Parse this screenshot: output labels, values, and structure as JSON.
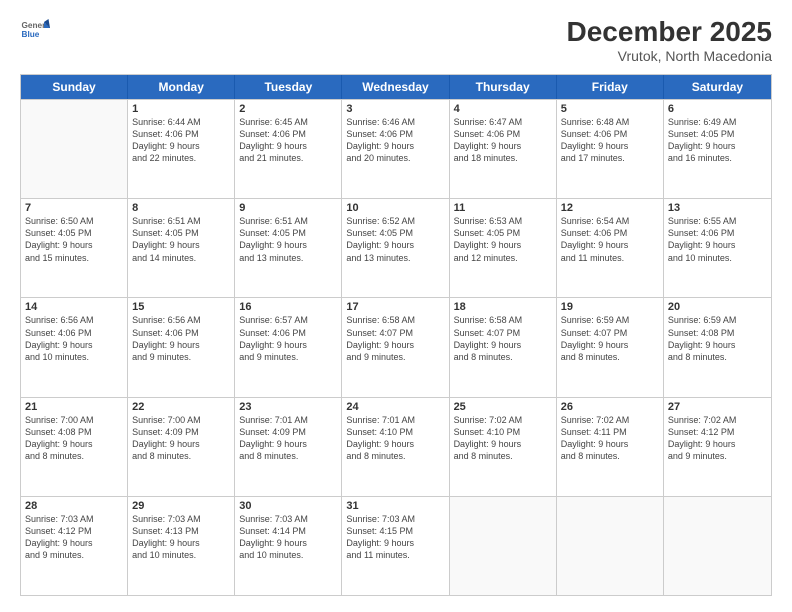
{
  "logo": {
    "general": "General",
    "blue": "Blue"
  },
  "title": "December 2025",
  "subtitle": "Vrutok, North Macedonia",
  "days": [
    "Sunday",
    "Monday",
    "Tuesday",
    "Wednesday",
    "Thursday",
    "Friday",
    "Saturday"
  ],
  "weeks": [
    [
      {
        "day": "",
        "info": ""
      },
      {
        "day": "1",
        "info": "Sunrise: 6:44 AM\nSunset: 4:06 PM\nDaylight: 9 hours\nand 22 minutes."
      },
      {
        "day": "2",
        "info": "Sunrise: 6:45 AM\nSunset: 4:06 PM\nDaylight: 9 hours\nand 21 minutes."
      },
      {
        "day": "3",
        "info": "Sunrise: 6:46 AM\nSunset: 4:06 PM\nDaylight: 9 hours\nand 20 minutes."
      },
      {
        "day": "4",
        "info": "Sunrise: 6:47 AM\nSunset: 4:06 PM\nDaylight: 9 hours\nand 18 minutes."
      },
      {
        "day": "5",
        "info": "Sunrise: 6:48 AM\nSunset: 4:06 PM\nDaylight: 9 hours\nand 17 minutes."
      },
      {
        "day": "6",
        "info": "Sunrise: 6:49 AM\nSunset: 4:05 PM\nDaylight: 9 hours\nand 16 minutes."
      }
    ],
    [
      {
        "day": "7",
        "info": "Sunrise: 6:50 AM\nSunset: 4:05 PM\nDaylight: 9 hours\nand 15 minutes."
      },
      {
        "day": "8",
        "info": "Sunrise: 6:51 AM\nSunset: 4:05 PM\nDaylight: 9 hours\nand 14 minutes."
      },
      {
        "day": "9",
        "info": "Sunrise: 6:51 AM\nSunset: 4:05 PM\nDaylight: 9 hours\nand 13 minutes."
      },
      {
        "day": "10",
        "info": "Sunrise: 6:52 AM\nSunset: 4:05 PM\nDaylight: 9 hours\nand 13 minutes."
      },
      {
        "day": "11",
        "info": "Sunrise: 6:53 AM\nSunset: 4:05 PM\nDaylight: 9 hours\nand 12 minutes."
      },
      {
        "day": "12",
        "info": "Sunrise: 6:54 AM\nSunset: 4:06 PM\nDaylight: 9 hours\nand 11 minutes."
      },
      {
        "day": "13",
        "info": "Sunrise: 6:55 AM\nSunset: 4:06 PM\nDaylight: 9 hours\nand 10 minutes."
      }
    ],
    [
      {
        "day": "14",
        "info": "Sunrise: 6:56 AM\nSunset: 4:06 PM\nDaylight: 9 hours\nand 10 minutes."
      },
      {
        "day": "15",
        "info": "Sunrise: 6:56 AM\nSunset: 4:06 PM\nDaylight: 9 hours\nand 9 minutes."
      },
      {
        "day": "16",
        "info": "Sunrise: 6:57 AM\nSunset: 4:06 PM\nDaylight: 9 hours\nand 9 minutes."
      },
      {
        "day": "17",
        "info": "Sunrise: 6:58 AM\nSunset: 4:07 PM\nDaylight: 9 hours\nand 9 minutes."
      },
      {
        "day": "18",
        "info": "Sunrise: 6:58 AM\nSunset: 4:07 PM\nDaylight: 9 hours\nand 8 minutes."
      },
      {
        "day": "19",
        "info": "Sunrise: 6:59 AM\nSunset: 4:07 PM\nDaylight: 9 hours\nand 8 minutes."
      },
      {
        "day": "20",
        "info": "Sunrise: 6:59 AM\nSunset: 4:08 PM\nDaylight: 9 hours\nand 8 minutes."
      }
    ],
    [
      {
        "day": "21",
        "info": "Sunrise: 7:00 AM\nSunset: 4:08 PM\nDaylight: 9 hours\nand 8 minutes."
      },
      {
        "day": "22",
        "info": "Sunrise: 7:00 AM\nSunset: 4:09 PM\nDaylight: 9 hours\nand 8 minutes."
      },
      {
        "day": "23",
        "info": "Sunrise: 7:01 AM\nSunset: 4:09 PM\nDaylight: 9 hours\nand 8 minutes."
      },
      {
        "day": "24",
        "info": "Sunrise: 7:01 AM\nSunset: 4:10 PM\nDaylight: 9 hours\nand 8 minutes."
      },
      {
        "day": "25",
        "info": "Sunrise: 7:02 AM\nSunset: 4:10 PM\nDaylight: 9 hours\nand 8 minutes."
      },
      {
        "day": "26",
        "info": "Sunrise: 7:02 AM\nSunset: 4:11 PM\nDaylight: 9 hours\nand 8 minutes."
      },
      {
        "day": "27",
        "info": "Sunrise: 7:02 AM\nSunset: 4:12 PM\nDaylight: 9 hours\nand 9 minutes."
      }
    ],
    [
      {
        "day": "28",
        "info": "Sunrise: 7:03 AM\nSunset: 4:12 PM\nDaylight: 9 hours\nand 9 minutes."
      },
      {
        "day": "29",
        "info": "Sunrise: 7:03 AM\nSunset: 4:13 PM\nDaylight: 9 hours\nand 10 minutes."
      },
      {
        "day": "30",
        "info": "Sunrise: 7:03 AM\nSunset: 4:14 PM\nDaylight: 9 hours\nand 10 minutes."
      },
      {
        "day": "31",
        "info": "Sunrise: 7:03 AM\nSunset: 4:15 PM\nDaylight: 9 hours\nand 11 minutes."
      },
      {
        "day": "",
        "info": ""
      },
      {
        "day": "",
        "info": ""
      },
      {
        "day": "",
        "info": ""
      }
    ]
  ]
}
